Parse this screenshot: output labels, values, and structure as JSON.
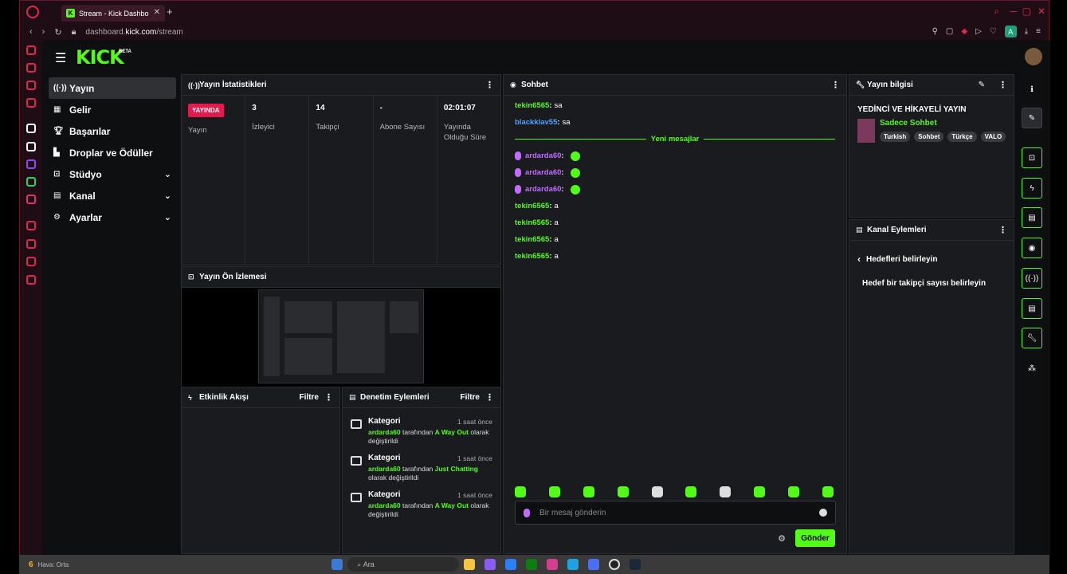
{
  "browser": {
    "tab_title": "Stream - Kick Dashbo",
    "url_prefix": "dashboard.",
    "url_domain": "kick.com",
    "url_path": "/stream"
  },
  "app": {
    "logo": "KICK",
    "beta": "BETA"
  },
  "sidebar": {
    "items": [
      {
        "label": "Yayın",
        "icon": "broadcast-icon",
        "active": true
      },
      {
        "label": "Gelir",
        "icon": "revenue-icon"
      },
      {
        "label": "Başarılar",
        "icon": "trophy-icon"
      },
      {
        "label": "Droplar ve Ödüller",
        "icon": "gift-icon"
      },
      {
        "label": "Stüdyo",
        "icon": "studio-icon",
        "expand": true
      },
      {
        "label": "Kanal",
        "icon": "channel-icon",
        "expand": true
      },
      {
        "label": "Ayarlar",
        "icon": "settings-icon",
        "expand": true
      }
    ]
  },
  "stats": {
    "title": "Yayın İstatistikleri",
    "live_badge": "YAYINDA",
    "items": [
      {
        "value": "",
        "label": "Yayın"
      },
      {
        "value": "3",
        "label": "İzleyici"
      },
      {
        "value": "14",
        "label": "Takipçi"
      },
      {
        "value": "-",
        "label": "Abone Sayısı"
      },
      {
        "value": "02:01:07",
        "label": "Yayında Olduğu Süre"
      }
    ]
  },
  "preview": {
    "title": "Yayın Ön İzlemesi"
  },
  "activity": {
    "title": "Etkinlik Akışı",
    "filter": "Filtre"
  },
  "moderation": {
    "title": "Denetim Eylemleri",
    "filter": "Filtre",
    "rows": [
      {
        "title": "Kategori",
        "time": "1 saat önce",
        "user": "ardarda60",
        "mid": " tarafından ",
        "cat": "A Way Out",
        "end": " olarak değiştirildi"
      },
      {
        "title": "Kategori",
        "time": "1 saat önce",
        "user": "ardarda60",
        "mid": " tarafından ",
        "cat": "Just Chatting",
        "end": " olarak değiştirildi"
      },
      {
        "title": "Kategori",
        "time": "1 saat önce",
        "user": "ardarda60",
        "mid": " tarafından ",
        "cat": "A Way Out",
        "end": " olarak değiştirildi"
      }
    ]
  },
  "chat": {
    "title": "Sohbet",
    "new_messages": "Yeni mesajlar",
    "placeholder": "Bir mesaj gönderin",
    "send": "Gönder",
    "messages_before": [
      {
        "user": "tekin6565",
        "text": "sa",
        "color": "#53fc18"
      },
      {
        "user": "blackklav55",
        "text": "sa",
        "color": "#4aa3ff"
      }
    ],
    "messages_after": [
      {
        "user": "ardarda60",
        "text": "",
        "color": "#c06cff",
        "emote": true
      },
      {
        "user": "ardarda60",
        "text": "",
        "color": "#c06cff",
        "emote": true
      },
      {
        "user": "ardarda60",
        "text": "",
        "color": "#c06cff",
        "emote": true
      },
      {
        "user": "tekin6565",
        "text": "a",
        "color": "#53fc18"
      },
      {
        "user": "tekin6565",
        "text": "a",
        "color": "#53fc18"
      },
      {
        "user": "tekin6565",
        "text": "a",
        "color": "#53fc18"
      },
      {
        "user": "tekin6565",
        "text": "a",
        "color": "#53fc18"
      }
    ]
  },
  "info": {
    "title": "Yayın bilgisi",
    "stream_title": "YEDİNCİ VE HİKAYELİ YAYIN",
    "category": "Sadece Sohbet",
    "tags": [
      "Turkish",
      "Sohbet",
      "Türkçe",
      "VALO"
    ]
  },
  "channel_actions": {
    "title": "Kanal Eylemleri",
    "back_label": "Hedefleri belirleyin",
    "goal": "Hedef bir takipçi sayısı belirleyin"
  },
  "taskbar": {
    "weather_count": "6",
    "weather": "Hava: Orta",
    "search": "Ara"
  }
}
